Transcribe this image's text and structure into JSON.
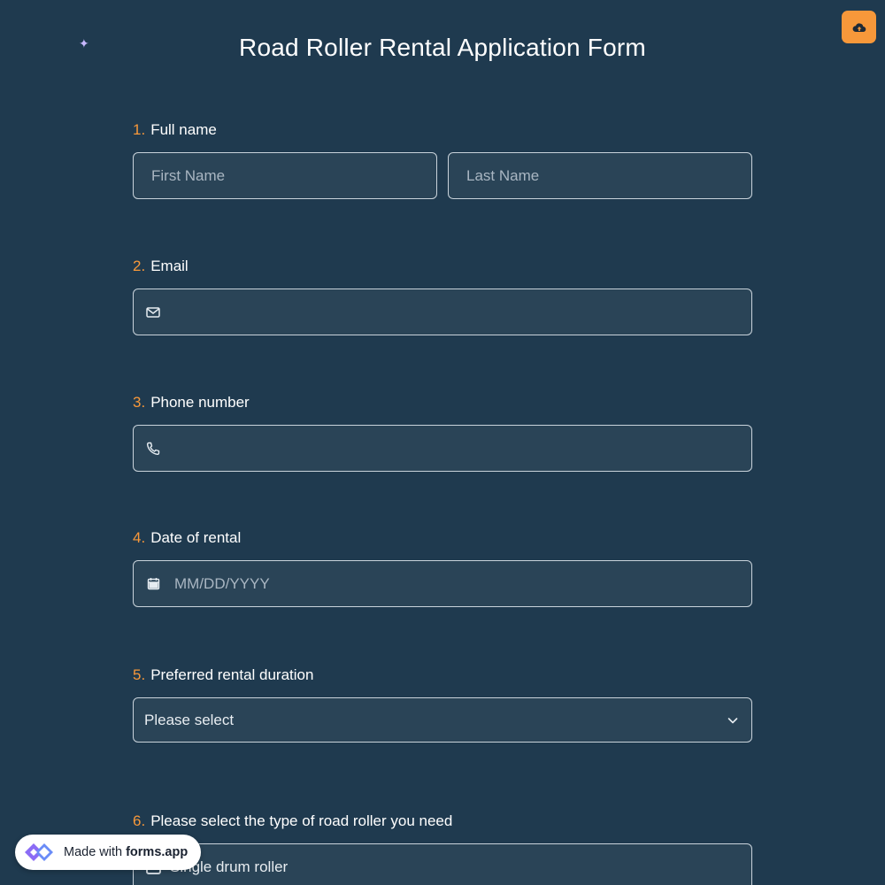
{
  "title": "Road Roller Rental Application Form",
  "icons": {
    "sparkle": "✦",
    "upload": "cloud-upload-icon",
    "email": "envelope-icon",
    "phone": "phone-icon",
    "calendar": "calendar-icon",
    "chevron": "chevron-down-icon",
    "badge_logo": "forms-app-logo"
  },
  "colors": {
    "background": "#1f3a4f",
    "accent": "#f7983a",
    "field_background": "#2a4457",
    "field_border": "#c9d3db"
  },
  "questions": [
    {
      "number": "1.",
      "label": "Full name",
      "first_placeholder": "First Name",
      "last_placeholder": "Last Name"
    },
    {
      "number": "2.",
      "label": "Email"
    },
    {
      "number": "3.",
      "label": "Phone number"
    },
    {
      "number": "4.",
      "label": "Date of rental",
      "placeholder": "MM/DD/YYYY"
    },
    {
      "number": "5.",
      "label": "Preferred rental duration",
      "selected": "Please select"
    },
    {
      "number": "6.",
      "label": "Please select the type of road roller you need",
      "options": [
        "Single drum roller"
      ]
    }
  ],
  "badge": {
    "prefix": "Made with",
    "brand": "forms.app"
  }
}
